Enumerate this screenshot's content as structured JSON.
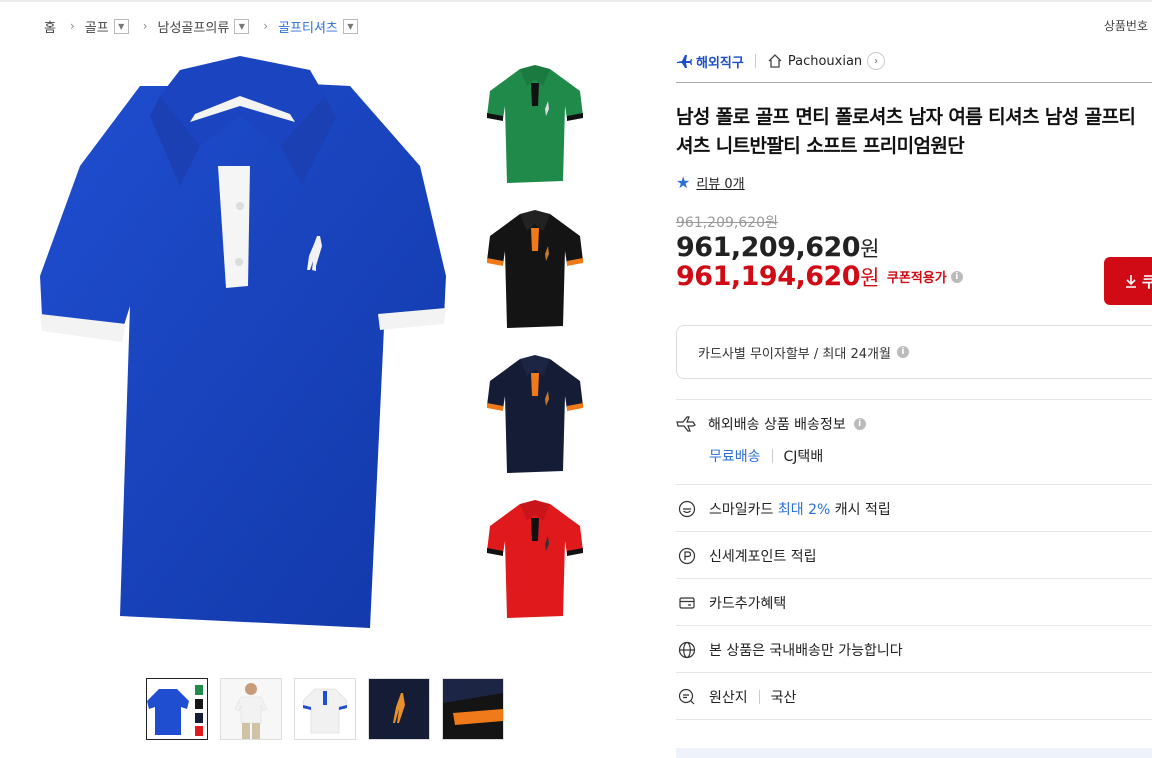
{
  "breadcrumb": {
    "items": [
      {
        "label": "홈",
        "dropdown": false
      },
      {
        "label": "골프",
        "dropdown": true
      },
      {
        "label": "남성골프의류",
        "dropdown": true
      },
      {
        "label": "골프티셔츠",
        "dropdown": true
      }
    ],
    "product_number_label": "상품번호"
  },
  "seller": {
    "overseas_label": "해외직구",
    "store_name": "Pachouxian"
  },
  "product": {
    "title": "남성 폴로 골프 면티 폴로셔츠 남자 여름 티셔츠 남성 골프티셔츠 니트반팔티 소프트 프리미엄원단",
    "review_label": "리뷰 0개"
  },
  "price": {
    "original": "961,209,620원",
    "sale_amount": "961,209,620",
    "coupon_amount": "961,194,620",
    "currency": "원",
    "coupon_label": "쿠폰적용가"
  },
  "coupon_button_label": "쿠",
  "installment_label": "카드사별 무이자할부 / 최대 24개월",
  "shipping": {
    "title": "해외배송 상품 배송정보",
    "free_label": "무료배송",
    "carrier": "CJ택배"
  },
  "benefits": {
    "smile_prefix": "스마일카드",
    "smile_highlight": "최대 2%",
    "smile_suffix": "캐시 적립",
    "point": "신세계포인트 적립",
    "card": "카드추가혜택",
    "domestic": "본 상품은 국내배송만 가능합니다",
    "origin_label": "원산지",
    "origin_value": "국산"
  },
  "colors": {
    "accent_blue": "#2b6fd6",
    "price_red": "#d10b16",
    "shirt_blue": "#1a45c4",
    "shirt_green": "#1f8a4a",
    "shirt_black": "#141414",
    "shirt_navy": "#151c35",
    "shirt_red": "#e0191c"
  },
  "icons": [
    "chevron-right-icon",
    "chevron-down-icon",
    "airplane-icon",
    "home-icon",
    "star-icon",
    "info-icon",
    "download-icon",
    "ship-icon",
    "smile-card-icon",
    "point-icon",
    "card-icon",
    "globe-icon",
    "origin-icon"
  ]
}
